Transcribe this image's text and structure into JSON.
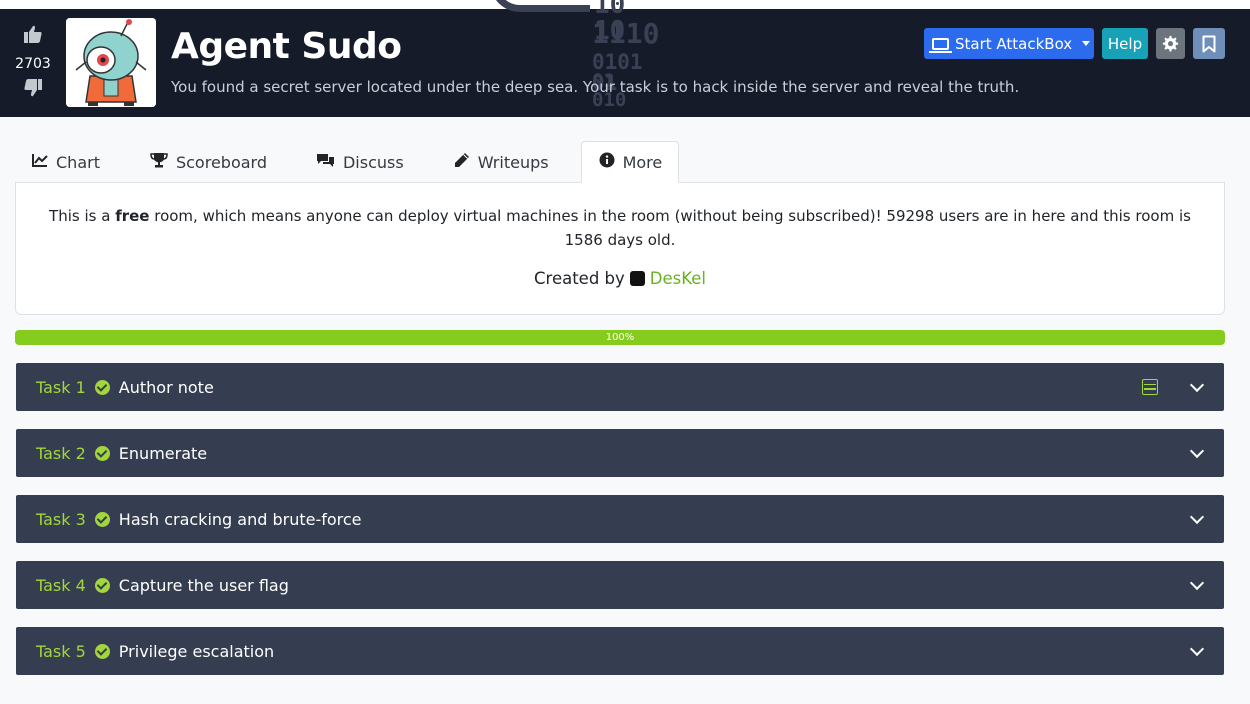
{
  "header": {
    "votes": "2703",
    "title": "Agent Sudo",
    "description": "You found a secret server located under the deep sea. Your task is to hack inside the server and reveal the truth.",
    "art": [
      "10  10",
      "1110",
      "0101  01",
      "01    010"
    ],
    "attackbox_label": "Start AttackBox",
    "help_label": "Help"
  },
  "tabs": [
    {
      "label": "Chart",
      "icon": "line-chart-icon"
    },
    {
      "label": "Scoreboard",
      "icon": "trophy-icon"
    },
    {
      "label": "Discuss",
      "icon": "comments-icon"
    },
    {
      "label": "Writeups",
      "icon": "pen-icon"
    },
    {
      "label": "More",
      "icon": "info-icon",
      "active": true
    }
  ],
  "info": {
    "text_pre": "This is a ",
    "text_bold": "free",
    "text_post": " room, which means anyone can deploy virtual machines in the room (without being subscribed)! 59298 users are in here and this room is 1586 days old.",
    "created_by": "Created by",
    "author": "DesKel"
  },
  "progress": {
    "value": 100,
    "label": "100%"
  },
  "tasks": [
    {
      "num": "Task 1",
      "title": "Author note",
      "completed": true
    },
    {
      "num": "Task 2",
      "title": "Enumerate",
      "completed": true
    },
    {
      "num": "Task 3",
      "title": "Hash cracking and brute-force",
      "completed": true
    },
    {
      "num": "Task 4",
      "title": "Capture the user flag",
      "completed": true
    },
    {
      "num": "Task 5",
      "title": "Privilege escalation",
      "completed": true
    }
  ],
  "colors": {
    "accent_green": "#a3d63a",
    "progress_green": "#86cc1f",
    "task_bg": "#353d51",
    "header_bg": "#151b29",
    "attackbox_blue": "#2c6bed",
    "help_teal": "#17a2b8"
  }
}
